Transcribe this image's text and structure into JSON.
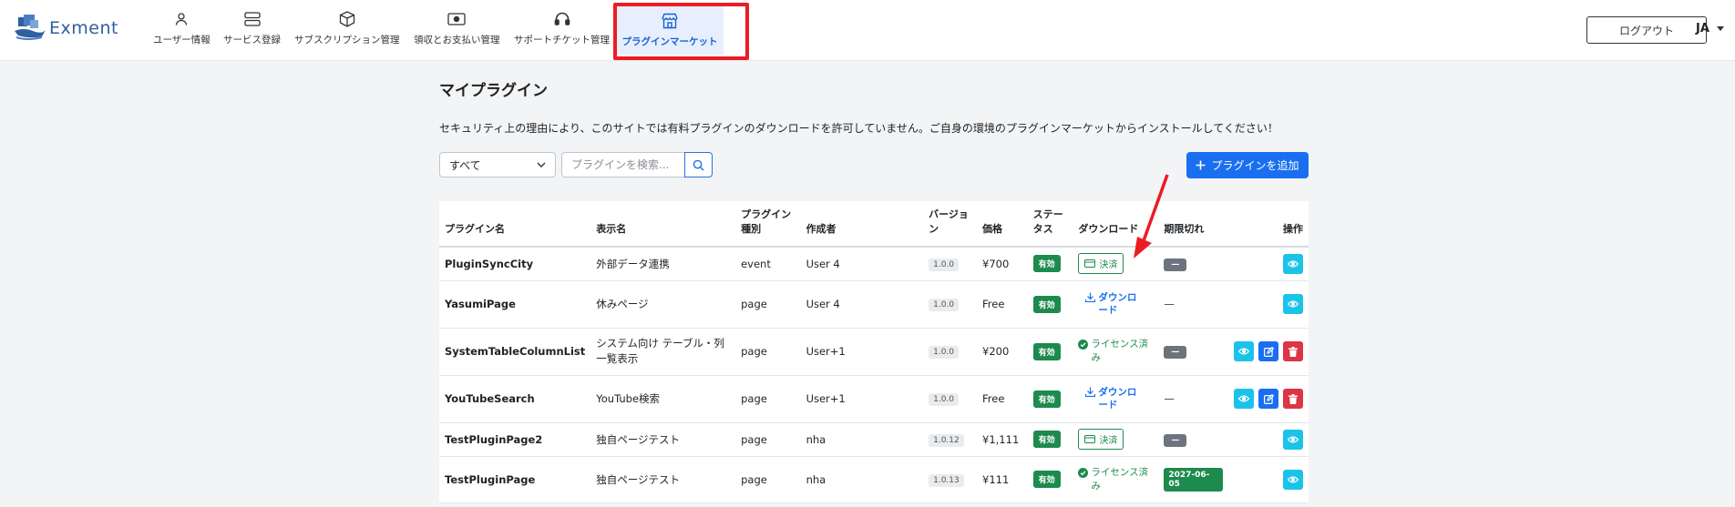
{
  "header": {
    "brand": "Exment",
    "nav": [
      {
        "label": "ユーザー情報",
        "icon": "user-icon"
      },
      {
        "label": "サービス登録",
        "icon": "server-icon"
      },
      {
        "label": "サブスクリプション管理",
        "icon": "box-icon"
      },
      {
        "label": "領収とお支払い管理",
        "icon": "cash-icon"
      },
      {
        "label": "サポートチケット管理",
        "icon": "headset-icon"
      },
      {
        "label": "プラグインマーケット",
        "icon": "shop-icon",
        "active": true
      }
    ],
    "logout_label": "ログアウト",
    "language": "JA"
  },
  "main": {
    "title": "マイプラグイン",
    "notice": "セキュリティ上の理由により、このサイトでは有料プラグインのダウンロードを許可していません。ご自身の環境のプラグインマーケットからインストールしてください！",
    "filter": {
      "selected": "すべて"
    },
    "search": {
      "placeholder": "プラグインを検索..."
    },
    "add_button_label": "プラグインを追加",
    "table": {
      "headers": {
        "name": "プラグイン名",
        "display": "表示名",
        "type": "プラグイン種別",
        "author": "作成者",
        "version": "バージョン",
        "price": "価格",
        "status": "ステータス",
        "download": "ダウンロード",
        "expiry": "期限切れ",
        "actions": "操作"
      },
      "rows": [
        {
          "name": "PluginSyncCity",
          "display": "外部データ連携",
          "type": "event",
          "author": "User 4",
          "version": "1.0.0",
          "price": "¥700",
          "status": "有効",
          "download": "決済",
          "expiry": "—"
        },
        {
          "name": "YasumiPage",
          "display": "休みページ",
          "type": "page",
          "author": "User 4",
          "version": "1.0.0",
          "price": "Free",
          "status": "有効",
          "download": "ダウンロード",
          "expiry": "—"
        },
        {
          "name": "SystemTableColumnList",
          "display": "システム向け テーブル・列一覧表示",
          "type": "page",
          "author": "User+1",
          "version": "1.0.0",
          "price": "¥200",
          "status": "有効",
          "download": "ライセンス済み",
          "expiry": "—"
        },
        {
          "name": "YouTubeSearch",
          "display": "YouTube検索",
          "type": "page",
          "author": "User+1",
          "version": "1.0.0",
          "price": "Free",
          "status": "有効",
          "download": "ダウンロード",
          "expiry": "—"
        },
        {
          "name": "TestPluginPage2",
          "display": "独自ページテスト",
          "type": "page",
          "author": "nha",
          "version": "1.0.12",
          "price": "¥1,111",
          "status": "有効",
          "download": "決済",
          "expiry": "—"
        },
        {
          "name": "TestPluginPage",
          "display": "独自ページテスト",
          "type": "page",
          "author": "nha",
          "version": "1.0.13",
          "price": "¥111",
          "status": "有効",
          "download": "ライセンス済み",
          "expiry": "2027-06-05"
        }
      ]
    }
  },
  "colors": {
    "accent": "#1a6ff0",
    "success": "#1d8a4e",
    "danger": "#dc3545",
    "info": "#1bc3e8",
    "highlight": "#ec1c24"
  }
}
